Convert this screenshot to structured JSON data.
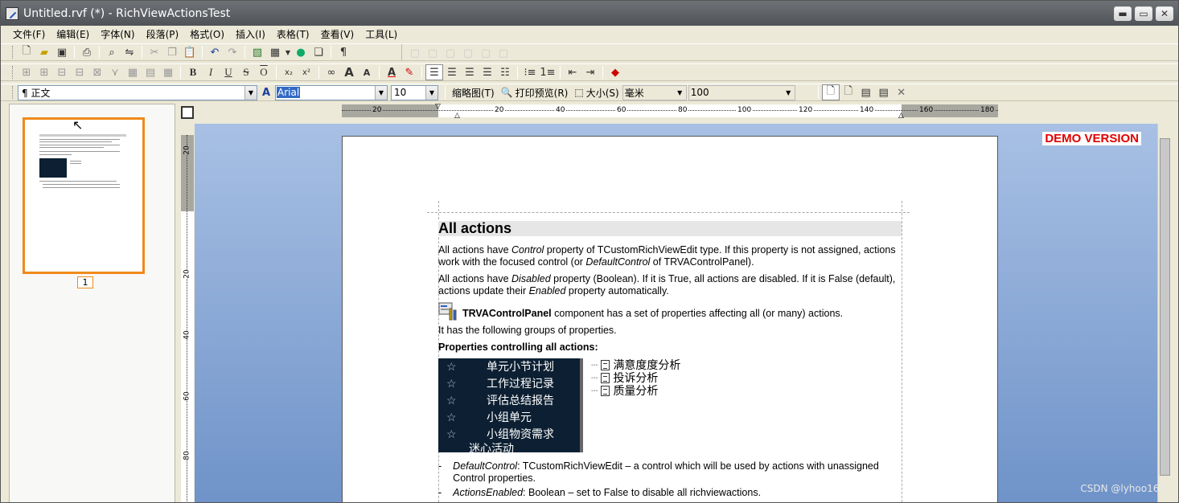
{
  "window": {
    "title": "Untitled.rvf (*) - RichViewActionsTest",
    "minimize": "▬",
    "maximize": "▭",
    "close": "✕"
  },
  "menu": [
    "文件(F)",
    "编辑(E)",
    "字体(N)",
    "段落(P)",
    "格式(O)",
    "插入(I)",
    "表格(T)",
    "查看(V)",
    "工具(L)"
  ],
  "format_bar": {
    "style": "¶ 正文",
    "font": "Arial",
    "size": "10",
    "thumbnails_label": "缩略图(T)",
    "print_preview_label": "打印预览(R)",
    "size_label": "大小(S)",
    "unit": "毫米",
    "zoom": "100"
  },
  "thumbnail": {
    "page_number": "1"
  },
  "ruler": {
    "h_ticks": [
      "20",
      "20",
      "40",
      "60",
      "80",
      "100",
      "120",
      "140",
      "160",
      "180"
    ],
    "v_ticks": [
      "20",
      "20",
      "40",
      "60",
      "80"
    ]
  },
  "demo_label": "DEMO VERSION",
  "document": {
    "heading": "All actions",
    "p1": {
      "a": "All actions have ",
      "b": "Control",
      "c": " property of TCustomRichViewEdit type. If this property is not assigned, actions work with the focused control (or ",
      "d": "DefaultControl",
      "e": " of TRVAControlPanel)."
    },
    "p2": {
      "a": "All actions have ",
      "b": "Disabled",
      "c": " property (Boolean). If it is True, all actions are disabled. If it is False (default), actions update their ",
      "d": "Enabled",
      "e": " property automatically."
    },
    "p3": {
      "bold": "TRVAControlPanel",
      "rest": " component has a set of properties affecting all (or many) actions."
    },
    "p4": "It has the following groups of properties.",
    "p5": "Properties controlling all actions:",
    "dark_list": [
      "单元小节计划",
      "工作过程记录",
      "评估总结报告",
      "小组单元",
      "小组物资需求",
      "迷心活动"
    ],
    "star": "☆",
    "tree": [
      "满意度度分析",
      "投诉分析",
      "质量分析"
    ],
    "b1": {
      "dash": "-",
      "italic": "DefaultControl",
      "rest": ": TCustomRichViewEdit – a control which will be used by actions with unassigned Control properties."
    },
    "b2": {
      "dash": "-",
      "italic": "ActionsEnabled",
      "rest": ": Boolean – set to False to disable all richviewactions."
    }
  },
  "watermark": "CSDN @lyhoo163"
}
